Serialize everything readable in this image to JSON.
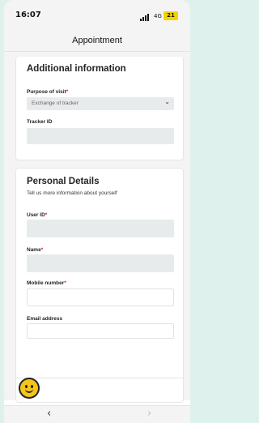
{
  "status_bar": {
    "time": "16:07",
    "network": "4G",
    "battery": "21"
  },
  "header": {
    "title": "Appointment"
  },
  "additional_info": {
    "title": "Additional information",
    "purpose_label": "Purpose of visit",
    "required_mark": "*",
    "purpose_value": "Exchange of tracker",
    "tracker_label": "Tracker ID",
    "tracker_value": ""
  },
  "personal_details": {
    "title": "Personal Details",
    "subtitle": "Tell us more information about yourself",
    "user_id_label": "User ID",
    "name_label": "Name",
    "mobile_label": "Mobile number",
    "email_label": "Email address",
    "required_mark": "*"
  },
  "icons": {
    "avatar": "smiley-face-icon",
    "back": "chevron-left-icon",
    "forward": "chevron-right-icon",
    "dropdown": "chevron-down-icon",
    "signal": "signal-bars-icon",
    "battery": "battery-icon"
  },
  "nav": {
    "back_glyph": "‹",
    "forward_glyph": "›"
  },
  "colors": {
    "background": "#dff1ec",
    "required": "#e02020",
    "battery": "#f2d300",
    "avatar": "#f5c518"
  }
}
